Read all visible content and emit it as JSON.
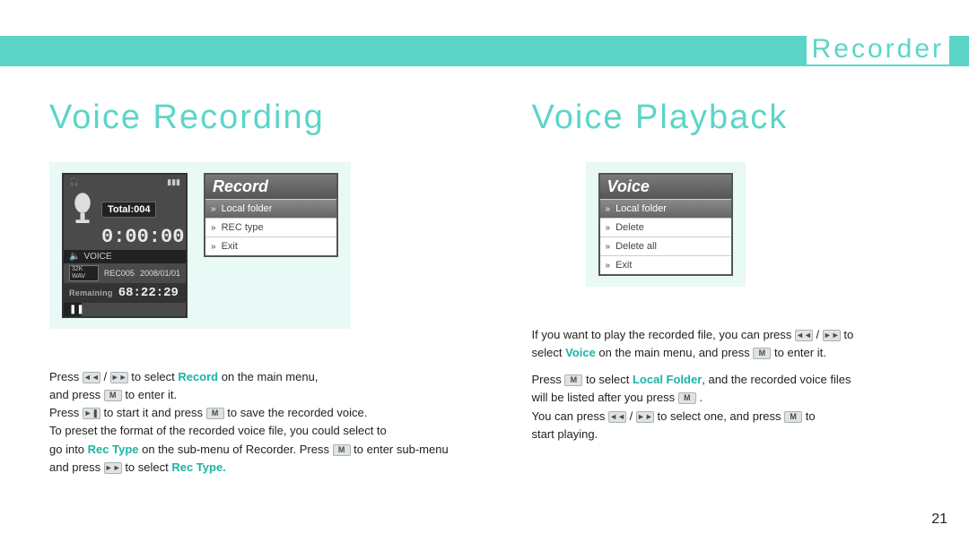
{
  "header": {
    "title": "Recorder"
  },
  "page_number": "21",
  "left": {
    "section_title": "Voice Recording",
    "device": {
      "total_label": "Total:004",
      "elapsed": "0:00:00",
      "voice_label": "VOICE",
      "wav_badge": "32K WAV",
      "file_name": "REC005",
      "file_date": "2008/01/01",
      "remaining_label": "Remaining",
      "remaining_time": "68:22:29"
    },
    "menu": {
      "title": "Record",
      "items": [
        "Local folder",
        "REC type",
        "Exit"
      ],
      "selected_index": 0
    },
    "instr": {
      "l1a": "Press ",
      "l1b": " / ",
      "l1c": " to select ",
      "l1_hl": "Record",
      "l1d": " on the main menu,",
      "l2a": "and press ",
      "l2b": " to enter it.",
      "l3a": "Press ",
      "l3b": " to start it and press ",
      "l3c": " to save the recorded voice.",
      "l4a": "To preset the format of the recorded voice file, you could select to",
      "l5a": "go into ",
      "l5_hl": "Rec Type",
      "l5b": " on the sub-menu of Recorder. Press ",
      "l5c": " to enter sub-menu",
      "l6a": "and press ",
      "l6b": " to select ",
      "l6_hl": "Rec Type."
    }
  },
  "right": {
    "section_title": "Voice Playback",
    "menu": {
      "title": "Voice",
      "items": [
        "Local folder",
        "Delete",
        "Delete all",
        "Exit"
      ],
      "selected_index": 0
    },
    "instr": {
      "l1a": "If you want to play the recorded file, you can press ",
      "l1b": " / ",
      "l1c": " to",
      "l2a": "select ",
      "l2_hl": "Voice",
      "l2b": " on the main menu, and press ",
      "l2c": " to enter it.",
      "l3a": "Press ",
      "l3b": " to select ",
      "l3_hl": "Local Folder",
      "l3c": ", and the recorded voice files",
      "l4a": "will be listed after you press ",
      "l4b": " .",
      "l5a": "You can press ",
      "l5b": " / ",
      "l5c": " to select one, and press ",
      "l5d": " to",
      "l6a": "start playing."
    }
  }
}
